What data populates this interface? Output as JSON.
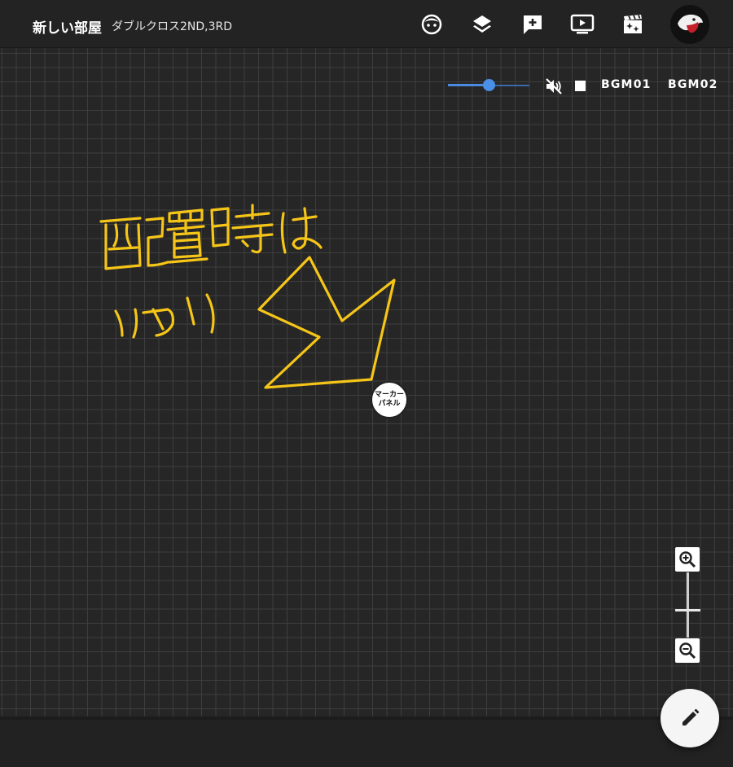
{
  "header": {
    "room_title": "新しい部屋",
    "room_subtitle": "ダブルクロス2ND,3RD",
    "icons": [
      "character-face-icon",
      "layers-icon",
      "add-note-icon",
      "video-play-icon",
      "movie-effect-icon",
      "user-avatar"
    ]
  },
  "bgm": {
    "volume": 0.5,
    "muted": true,
    "tracks": [
      "BGM01",
      "BGM02"
    ]
  },
  "board": {
    "handwritten_annotation": "配置時は ココ",
    "marker_panel_label": [
      "マーカー",
      "パネル"
    ],
    "annotation_color": "#f5c518"
  },
  "zoom": {
    "zoom_in_icon": "zoom-in-icon",
    "zoom_out_icon": "zoom-out-icon"
  },
  "fab": {
    "icon": "pencil-icon"
  }
}
